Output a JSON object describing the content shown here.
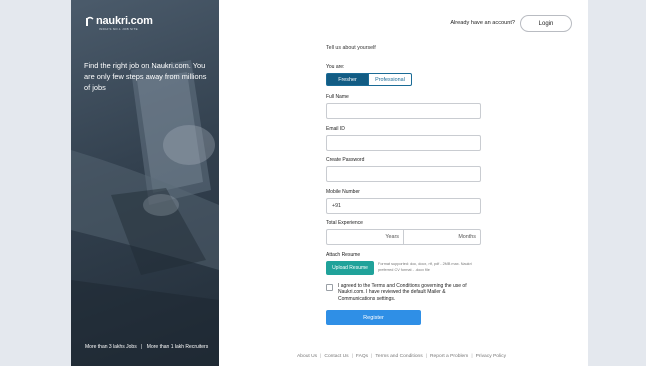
{
  "brand": {
    "name": "naukri.com",
    "tagline": "INDIA'S NO.1 JOB SITE"
  },
  "left_panel": {
    "headline": "Find the right job on Naukri.com. You are only few steps away from millions of jobs",
    "stats": [
      "More than 3 lakhs Jobs",
      "More than 1 lakh Recruiters"
    ],
    "stats_separator": "|"
  },
  "header": {
    "account_prompt": "Already have an account?",
    "login_label": "Login"
  },
  "form": {
    "intro": "Tell us about yourself",
    "you_are_label": "You are:",
    "options": [
      "Fresher",
      "Professional"
    ],
    "selected_option": "Fresher",
    "full_name_label": "Full Name",
    "full_name_value": "",
    "email_label": "Email ID",
    "email_value": "",
    "password_label": "Create Password",
    "password_value": "",
    "mobile_label": "Mobile Number",
    "mobile_prefix": "+91",
    "mobile_value": "",
    "experience_label": "Total Experience",
    "years_placeholder": "Years",
    "months_placeholder": "Months",
    "resume_label": "Attach Resume",
    "upload_label": "Upload Resume",
    "resume_formats": "Format supported: doc, docx, rtf, pdf - 2MB max. Naukri preferred CV format - .docx file",
    "agree_checked": false,
    "agree_text": "I agreed to the Terms and Conditions governing the use of Naukri.com. I have reviewed the default Mailer & Communications settings.",
    "register_label": "Register"
  },
  "footer": {
    "links": [
      "About Us",
      "Contact Us",
      "FAQs",
      "Terms and Conditions",
      "Report a Problem",
      "Privacy Policy"
    ],
    "separator": "|"
  },
  "colors": {
    "primary_blue": "#125c84",
    "register_blue": "#2f8fe6",
    "upload_teal": "#20a29a",
    "left_panel": "#33414f",
    "page_bg": "#e4e8ee"
  }
}
